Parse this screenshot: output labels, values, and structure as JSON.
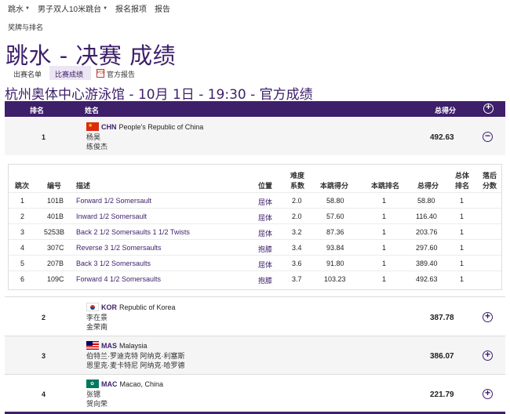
{
  "top_nav": [
    {
      "label": "跳水",
      "has_menu": true
    },
    {
      "label": "男子双人10米跳台",
      "has_menu": true
    },
    {
      "label": "报名报项",
      "has_menu": false
    },
    {
      "label": "报告",
      "has_menu": false
    }
  ],
  "sub_link": "奖牌与排名",
  "page_title": "跳水 - 决赛 成绩",
  "tabs": [
    {
      "label": "出赛名单",
      "active": false
    },
    {
      "label": "比赛成绩",
      "active": true
    },
    {
      "label": "官方报告",
      "active": false,
      "icon": "pdf-icon",
      "icon_text": "PDF"
    }
  ],
  "venue_line": "杭州奥体中心游泳馆 - 10月 1日 - 19:30 - 官方成绩",
  "table_header": {
    "rank": "排名",
    "name": "姓名",
    "total": "总得分"
  },
  "dive_columns": {
    "round": "跳次",
    "number": "编号",
    "description": "描述",
    "position": "位置",
    "difficulty": [
      "难度",
      "系数"
    ],
    "dive_score": "本跳得分",
    "dive_rank": "本跳排名",
    "total": "总得分",
    "overall_rank": [
      "总体",
      "排名"
    ],
    "behind": [
      "落后",
      "分数"
    ]
  },
  "results": [
    {
      "rank": "1",
      "code": "CHN",
      "country": "People's Republic of China",
      "athletes": [
        "杨昊",
        "练俊杰"
      ],
      "total": "492.63",
      "expanded": true,
      "flag": "chn"
    },
    {
      "rank": "2",
      "code": "KOR",
      "country": "Republic of Korea",
      "athletes": [
        "李在景",
        "金荣南"
      ],
      "total": "387.78",
      "expanded": false,
      "flag": "kor"
    },
    {
      "rank": "3",
      "code": "MAS",
      "country": "Malaysia",
      "athletes": [
        "伯特兰·罗迪克特 阿纳克·利塞斯",
        "恩里克·麦卡特尼 阿纳克·哈罗德"
      ],
      "total": "386.07",
      "expanded": false,
      "flag": "mas"
    },
    {
      "rank": "4",
      "code": "MAC",
      "country": "Macao, China",
      "athletes": [
        "张锶",
        "贺向荣"
      ],
      "total": "221.79",
      "expanded": false,
      "flag": "mac"
    }
  ],
  "dives": [
    {
      "round": "1",
      "number": "101B",
      "description": "Forward 1/2 Somersault",
      "position": "屈体",
      "difficulty": "2.0",
      "score": "58.80",
      "dive_rank": "1",
      "total": "58.80",
      "overall": "1",
      "behind": ""
    },
    {
      "round": "2",
      "number": "401B",
      "description": "Inward 1/2 Somersault",
      "position": "屈体",
      "difficulty": "2.0",
      "score": "57.60",
      "dive_rank": "1",
      "total": "116.40",
      "overall": "1",
      "behind": ""
    },
    {
      "round": "3",
      "number": "5253B",
      "description": "Back 2 1/2 Somersaults 1 1/2 Twists",
      "position": "屈体",
      "difficulty": "3.2",
      "score": "87.36",
      "dive_rank": "1",
      "total": "203.76",
      "overall": "1",
      "behind": ""
    },
    {
      "round": "4",
      "number": "307C",
      "description": "Reverse 3 1/2 Somersaults",
      "position": "抱膝",
      "difficulty": "3.4",
      "score": "93.84",
      "dive_rank": "1",
      "total": "297.60",
      "overall": "1",
      "behind": ""
    },
    {
      "round": "5",
      "number": "207B",
      "description": "Back 3 1/2 Somersaults",
      "position": "屈体",
      "difficulty": "3.6",
      "score": "91.80",
      "dive_rank": "1",
      "total": "389.40",
      "overall": "1",
      "behind": ""
    },
    {
      "round": "6",
      "number": "109C",
      "description": "Forward 4 1/2 Somersaults",
      "position": "抱膝",
      "difficulty": "3.7",
      "score": "103.23",
      "dive_rank": "1",
      "total": "492.63",
      "overall": "1",
      "behind": ""
    }
  ],
  "colors": {
    "brand": "#3d1f6a",
    "tab_active_bg": "#ece5f3",
    "row_alt_bg": "#f5f5f5"
  },
  "icons": {
    "expand": "plus-circle-icon",
    "collapse": "minus-circle-icon",
    "menu": "caret-down-icon"
  }
}
